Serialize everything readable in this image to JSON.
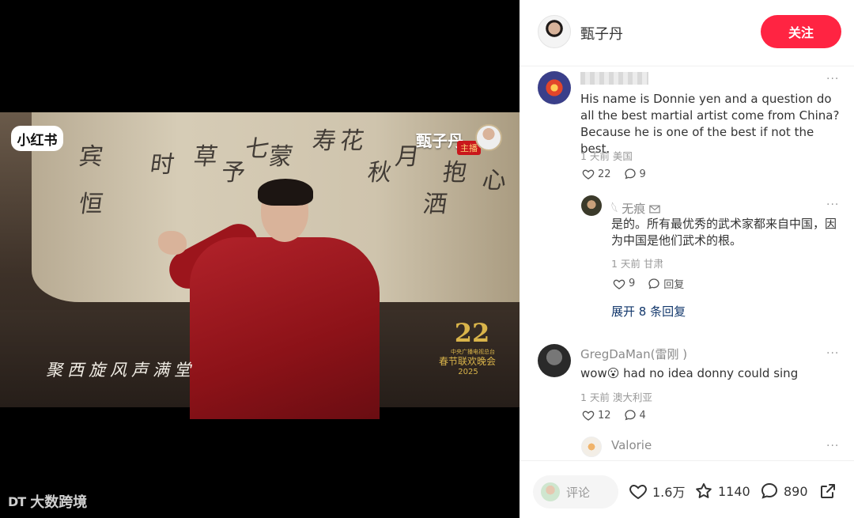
{
  "video": {
    "logo": "小红书",
    "host_name": "甄子丹",
    "host_tag": "主播",
    "lyric": "聚西旋风声满堂",
    "gala_mark": "22",
    "gala_org": "中央广播电视总台",
    "gala_name": "春节联欢晚会",
    "gala_year": "2025",
    "calligraphy": [
      "宾",
      "恒",
      "时",
      "草",
      "予",
      "七",
      "蒙",
      "寿",
      "花",
      "秋",
      "月",
      "洒",
      "抱",
      "心"
    ],
    "watermark": "大数跨境",
    "watermark_icon": "DT"
  },
  "header": {
    "author_name": "甄子丹",
    "follow_label": "关注"
  },
  "comments": [
    {
      "user": "",
      "text": "His name is Donnie yen and a question do all the best martial artist come from China? Because he is one of the best if not the best.",
      "time": "1 天前",
      "location": "美国",
      "likes": "22",
      "replies": "9"
    },
    {
      "user": "𓆩 无痕",
      "user_icon": "envelope-icon",
      "text_line1": "是的。所有最优秀的武术家都来自中国，因",
      "text_line2": "为中国是他们武术的根。",
      "time": "1 天前",
      "location": "甘肃",
      "likes": "9",
      "reply_label": "回复"
    },
    {
      "user": "GregDaMan(雷刚 )",
      "text_before": "wow",
      "emoji": "😮",
      "text_after": "had no idea donny could sing",
      "time": "1 天前",
      "location": "澳大利亚",
      "likes": "12",
      "replies": "4"
    },
    {
      "user": "Valorie"
    }
  ],
  "expand_replies": "展开 8 条回复",
  "more_icon": "···",
  "bottom_bar": {
    "comment_placeholder": "评论",
    "likes": "1.6万",
    "stars": "1140",
    "comments": "890"
  },
  "colors": {
    "follow_button": "#ff2442",
    "expand_link": "#13386c"
  }
}
